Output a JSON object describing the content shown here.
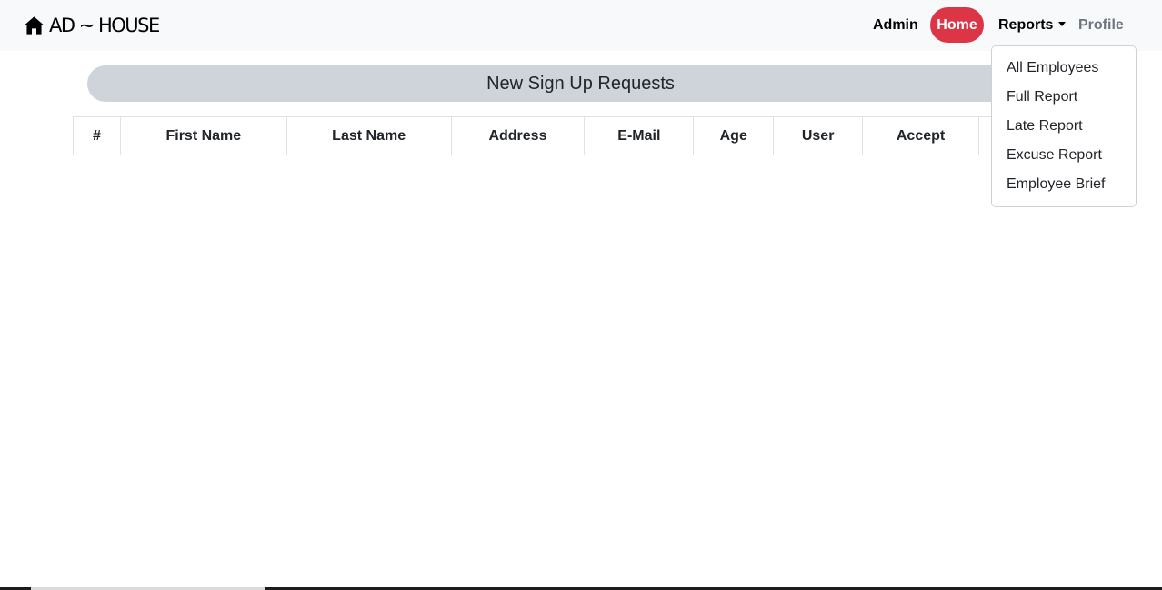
{
  "brand": {
    "text": "AD ~ HOUSE",
    "icon": "home-icon"
  },
  "nav": {
    "admin": "Admin",
    "home": "Home",
    "reports": "Reports",
    "profile": "Profile"
  },
  "dropdown": {
    "items": [
      {
        "label": "All Employees"
      },
      {
        "label": "Full Report"
      },
      {
        "label": "Late Report"
      },
      {
        "label": "Excuse Report"
      },
      {
        "label": "Employee Brief"
      }
    ]
  },
  "main": {
    "title": "New Sign Up Requests",
    "table": {
      "headers": [
        "#",
        "First Name",
        "Last Name",
        "Address",
        "E-Mail",
        "Age",
        "User",
        "Accept",
        ""
      ]
    }
  },
  "colors": {
    "home_button_bg": "#dc3545",
    "banner_bg": "#cfd4db",
    "navbar_bg": "#f8f9fa",
    "profile_text": "#6c757d"
  }
}
